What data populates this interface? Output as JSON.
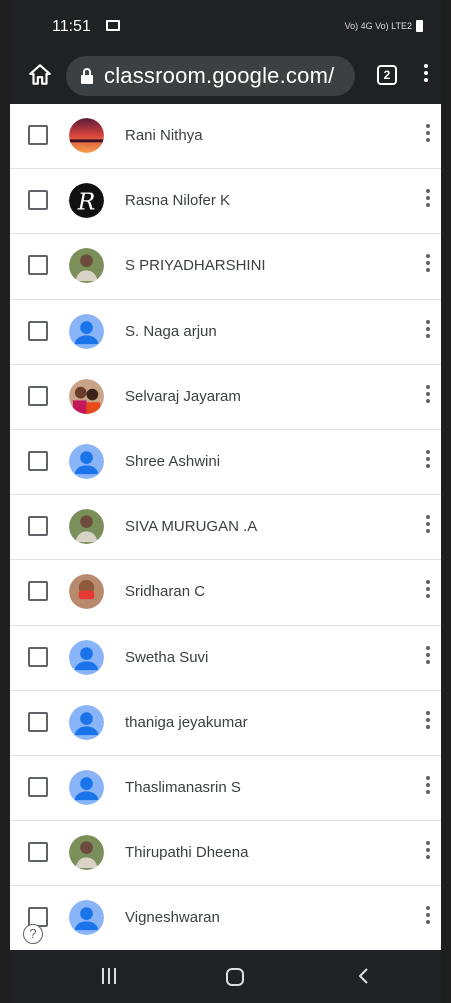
{
  "status_bar": {
    "time": "11:51",
    "network": "Vo) 4G  Vo) LTE2"
  },
  "browser": {
    "url": "classroom.google.com/",
    "tab_count": "2"
  },
  "students": [
    {
      "name": "Rani Nithya",
      "avatar": "photo-sunset"
    },
    {
      "name": "Rasna Nilofer K",
      "avatar": "photo-letter-r"
    },
    {
      "name": "S PRIYADHARSHINI",
      "avatar": "photo-person"
    },
    {
      "name": "S. Naga arjun",
      "avatar": "default-person"
    },
    {
      "name": "Selvaraj Jayaram",
      "avatar": "photo-couple"
    },
    {
      "name": "Shree Ashwini",
      "avatar": "default-person"
    },
    {
      "name": "SIVA MURUGAN .A",
      "avatar": "photo-person"
    },
    {
      "name": "Sridharan C",
      "avatar": "photo-mask"
    },
    {
      "name": "Swetha Suvi",
      "avatar": "default-person"
    },
    {
      "name": "thaniga jeyakumar",
      "avatar": "default-person"
    },
    {
      "name": "Thaslimanasrin S",
      "avatar": "default-person"
    },
    {
      "name": "Thirupathi Dheena",
      "avatar": "photo-person"
    },
    {
      "name": "Vigneshwaran",
      "avatar": "default-person"
    }
  ],
  "colors": {
    "default_avatar": "#8ab4f8",
    "default_avatar_figure": "#1a73e8",
    "toolbar": "#202124"
  }
}
